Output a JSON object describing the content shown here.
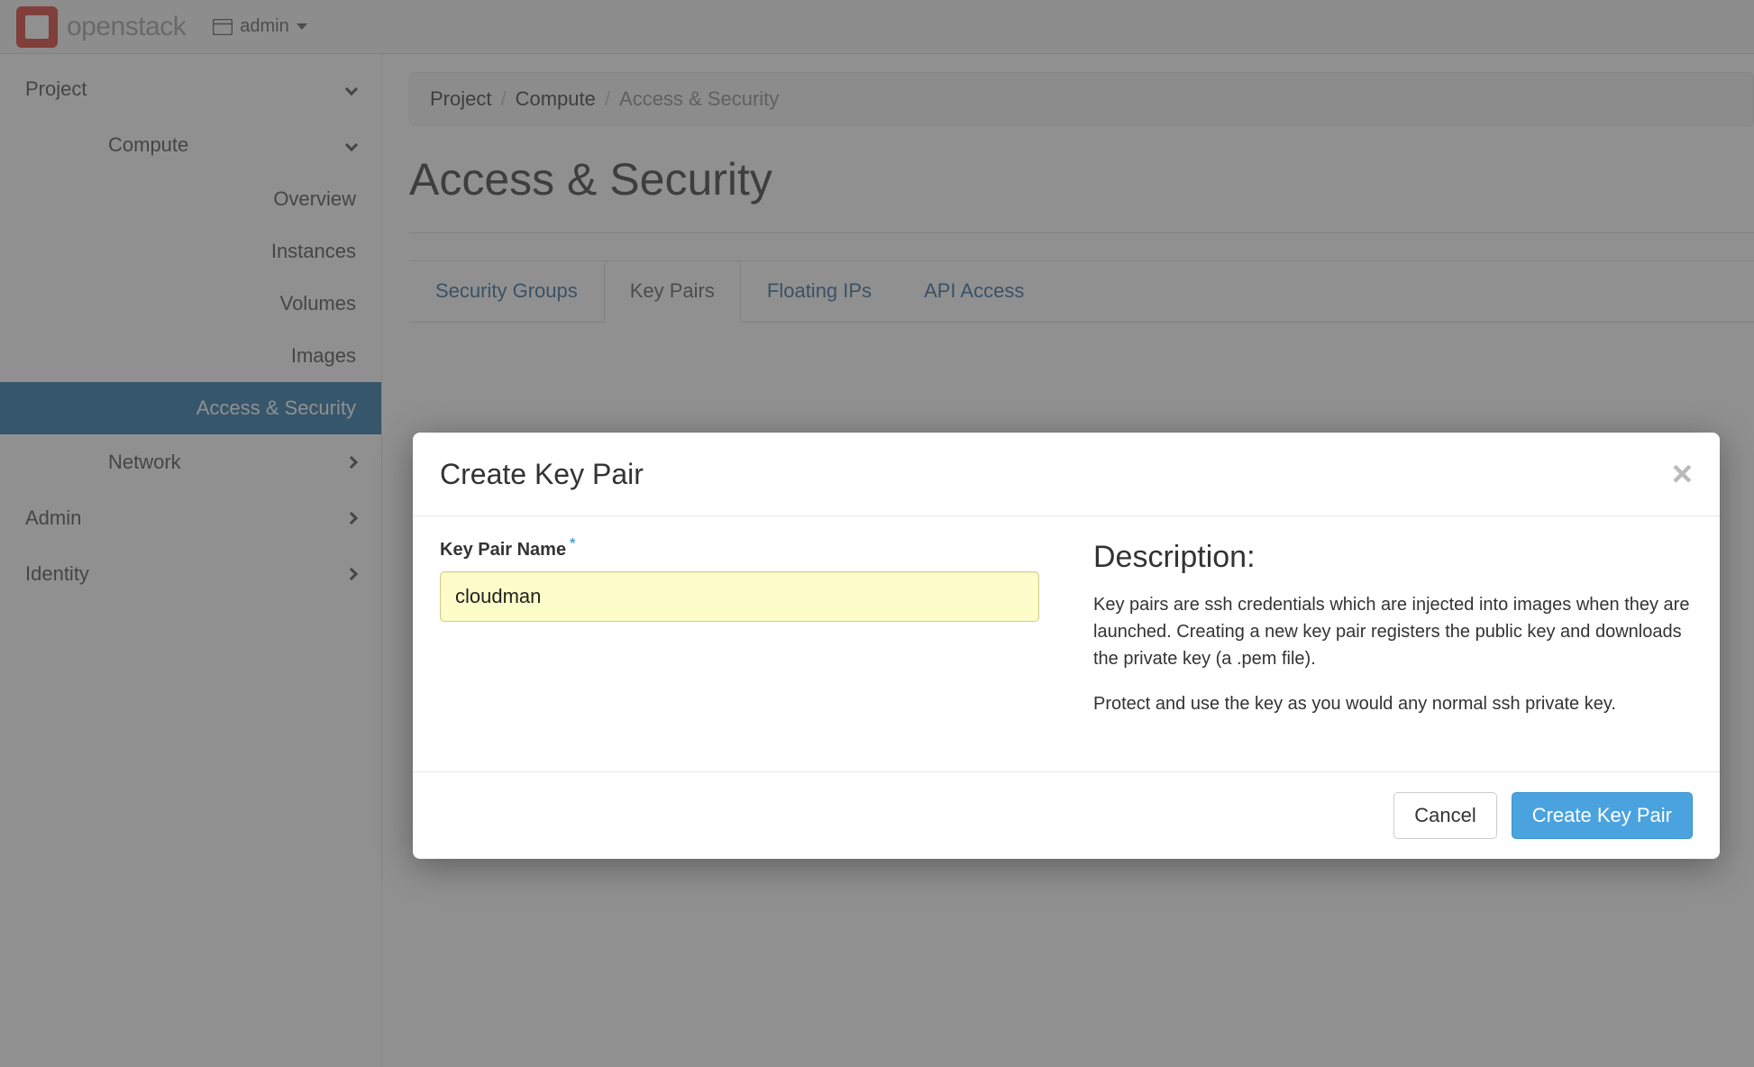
{
  "topbar": {
    "brand": "openstack",
    "tenant": "admin"
  },
  "sidebar": {
    "project": {
      "label": "Project"
    },
    "compute": {
      "label": "Compute",
      "items": {
        "overview": "Overview",
        "instances": "Instances",
        "volumes": "Volumes",
        "images": "Images",
        "access": "Access & Security"
      }
    },
    "network": {
      "label": "Network"
    },
    "admin": {
      "label": "Admin"
    },
    "identity": {
      "label": "Identity"
    }
  },
  "breadcrumb": {
    "a": "Project",
    "b": "Compute",
    "c": "Access & Security"
  },
  "page": {
    "title": "Access & Security"
  },
  "tabs": {
    "secgroups": "Security Groups",
    "keypairs": "Key Pairs",
    "floating": "Floating IPs",
    "api": "API Access"
  },
  "modal": {
    "title": "Create Key Pair",
    "form": {
      "label": "Key Pair Name",
      "value": "cloudman"
    },
    "desc": {
      "heading": "Description:",
      "p1": "Key pairs are ssh credentials which are injected into images when they are launched. Creating a new key pair registers the public key and downloads the private key (a .pem file).",
      "p2": "Protect and use the key as you would any normal ssh private key."
    },
    "buttons": {
      "cancel": "Cancel",
      "submit": "Create Key Pair"
    }
  }
}
